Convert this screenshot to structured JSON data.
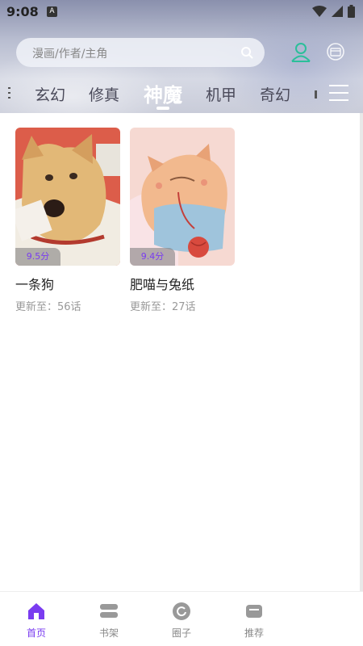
{
  "status_bar": {
    "time": "9:08",
    "app_badge": "A"
  },
  "search": {
    "placeholder": "漫画/作者/主角"
  },
  "tabs": [
    {
      "label": "玄幻",
      "active": false
    },
    {
      "label": "修真",
      "active": false
    },
    {
      "label": "神魔",
      "active": true
    },
    {
      "label": "机甲",
      "active": false
    },
    {
      "label": "奇幻",
      "active": false
    }
  ],
  "comics": [
    {
      "title": "一条狗",
      "score": "9.5分",
      "update": "更新至：56话"
    },
    {
      "title": "肥喵与兔纸",
      "score": "9.4分",
      "update": "更新至：27话"
    }
  ],
  "bottom_nav": [
    {
      "label": "首页",
      "icon": "home-icon",
      "active": true
    },
    {
      "label": "书架",
      "icon": "bookshelf-icon",
      "active": false
    },
    {
      "label": "圈子",
      "icon": "circle-icon",
      "active": false
    },
    {
      "label": "推荐",
      "icon": "recommend-icon",
      "active": false
    }
  ],
  "colors": {
    "accent": "#7a3cf0",
    "user_icon": "#2bbf9a"
  }
}
